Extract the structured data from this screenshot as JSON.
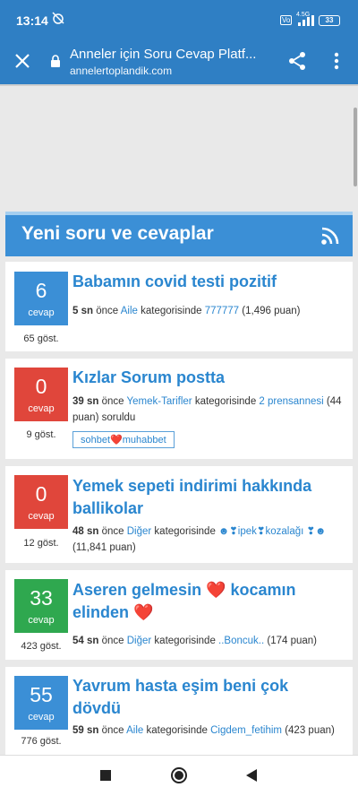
{
  "status": {
    "time": "13:14",
    "volte": "Vo",
    "network": "4.5G",
    "battery": "33"
  },
  "browser": {
    "page_title": "Anneler için Soru Cevap Platf...",
    "domain": "annelertoplandik.com"
  },
  "section": {
    "title": "Yeni soru ve cevaplar"
  },
  "questions": [
    {
      "count": "6",
      "count_label": "cevap",
      "color": "#3b8fd6",
      "views": "65 göst.",
      "title": "Babamın covid testi pozitif",
      "time": "5 sn",
      "ago": " önce ",
      "category": "Aile",
      "in_cat": " kategorisinde ",
      "user": "777777",
      "points": " (1,496 puan)"
    },
    {
      "count": "0",
      "count_label": "cevap",
      "color": "#e0463b",
      "views": "9 göst.",
      "title": "Kızlar Sorum postta",
      "time": "39 sn",
      "ago": " önce ",
      "category": "Yemek-Tarifler",
      "in_cat": " kategorisinde ",
      "user": "2 prensannesi",
      "points": " (44 puan) soruldu",
      "tag_pre": "sohbet",
      "tag_heart": "❤️",
      "tag_post": "muhabbet"
    },
    {
      "count": "0",
      "count_label": "cevap",
      "color": "#e0463b",
      "views": "12 göst.",
      "title": "Yemek sepeti indirimi hakkında ballikolar",
      "time": "48 sn",
      "ago": " önce ",
      "category": "Diğer",
      "in_cat": " kategorisinde ",
      "user": "☻❣ipek❣kozalağı ❣☻",
      "points": " (11,841 puan)"
    },
    {
      "count": "33",
      "count_label": "cevap",
      "color": "#2fa84f",
      "views": "423 göst.",
      "title": "Aseren gelmesin ❤️ kocamın elinden ❤️",
      "time": "54 sn",
      "ago": " önce ",
      "category": "Diğer",
      "in_cat": " kategorisinde ",
      "user": "..Boncuk..",
      "points": " (174 puan)"
    },
    {
      "count": "55",
      "count_label": "cevap",
      "color": "#3b8fd6",
      "views": "776 göst.",
      "title": "Yavrum hasta eşim beni çok dövdü",
      "time": "59 sn",
      "ago": " önce ",
      "category": "Aile",
      "in_cat": " kategorisinde ",
      "user": "Cigdem_fetihim",
      "points": " (423 puan)"
    }
  ],
  "icons": {
    "close": "close-icon",
    "lock": "lock-icon",
    "share": "share-icon",
    "more": "more-vert-icon",
    "rss": "rss-icon"
  }
}
